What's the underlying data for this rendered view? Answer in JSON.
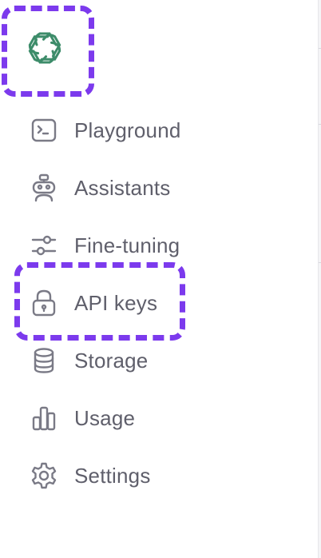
{
  "brand": {
    "logo_icon": "openai-logo-icon",
    "logo_color": "#3d8c6a"
  },
  "highlight_color": "#7c3aed",
  "sidebar": {
    "items": [
      {
        "label": "Playground",
        "icon": "terminal-icon"
      },
      {
        "label": "Assistants",
        "icon": "robot-icon"
      },
      {
        "label": "Fine-tuning",
        "icon": "sliders-icon"
      },
      {
        "label": "API keys",
        "icon": "lock-icon"
      },
      {
        "label": "Storage",
        "icon": "database-icon"
      },
      {
        "label": "Usage",
        "icon": "bar-chart-icon"
      },
      {
        "label": "Settings",
        "icon": "gear-icon"
      }
    ]
  }
}
